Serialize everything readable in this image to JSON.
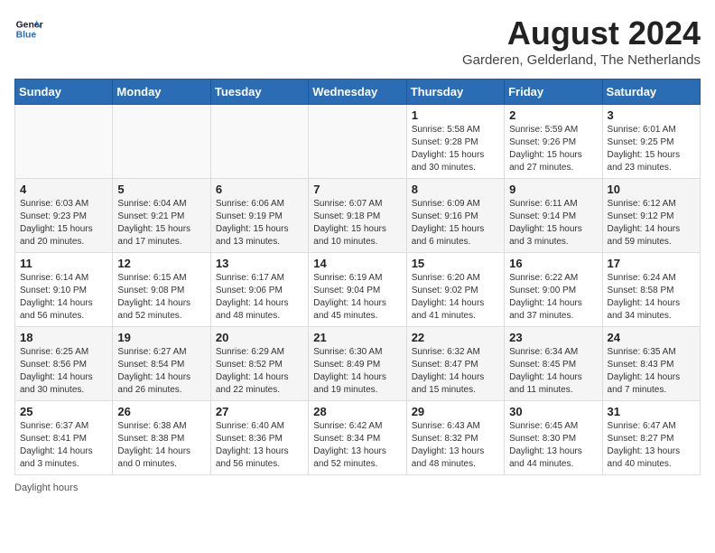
{
  "header": {
    "logo_line1": "General",
    "logo_line2": "Blue",
    "month_year": "August 2024",
    "location": "Garderen, Gelderland, The Netherlands"
  },
  "weekdays": [
    "Sunday",
    "Monday",
    "Tuesday",
    "Wednesday",
    "Thursday",
    "Friday",
    "Saturday"
  ],
  "weeks": [
    [
      {
        "day": "",
        "info": ""
      },
      {
        "day": "",
        "info": ""
      },
      {
        "day": "",
        "info": ""
      },
      {
        "day": "",
        "info": ""
      },
      {
        "day": "1",
        "info": "Sunrise: 5:58 AM\nSunset: 9:28 PM\nDaylight: 15 hours and 30 minutes."
      },
      {
        "day": "2",
        "info": "Sunrise: 5:59 AM\nSunset: 9:26 PM\nDaylight: 15 hours and 27 minutes."
      },
      {
        "day": "3",
        "info": "Sunrise: 6:01 AM\nSunset: 9:25 PM\nDaylight: 15 hours and 23 minutes."
      }
    ],
    [
      {
        "day": "4",
        "info": "Sunrise: 6:03 AM\nSunset: 9:23 PM\nDaylight: 15 hours and 20 minutes."
      },
      {
        "day": "5",
        "info": "Sunrise: 6:04 AM\nSunset: 9:21 PM\nDaylight: 15 hours and 17 minutes."
      },
      {
        "day": "6",
        "info": "Sunrise: 6:06 AM\nSunset: 9:19 PM\nDaylight: 15 hours and 13 minutes."
      },
      {
        "day": "7",
        "info": "Sunrise: 6:07 AM\nSunset: 9:18 PM\nDaylight: 15 hours and 10 minutes."
      },
      {
        "day": "8",
        "info": "Sunrise: 6:09 AM\nSunset: 9:16 PM\nDaylight: 15 hours and 6 minutes."
      },
      {
        "day": "9",
        "info": "Sunrise: 6:11 AM\nSunset: 9:14 PM\nDaylight: 15 hours and 3 minutes."
      },
      {
        "day": "10",
        "info": "Sunrise: 6:12 AM\nSunset: 9:12 PM\nDaylight: 14 hours and 59 minutes."
      }
    ],
    [
      {
        "day": "11",
        "info": "Sunrise: 6:14 AM\nSunset: 9:10 PM\nDaylight: 14 hours and 56 minutes."
      },
      {
        "day": "12",
        "info": "Sunrise: 6:15 AM\nSunset: 9:08 PM\nDaylight: 14 hours and 52 minutes."
      },
      {
        "day": "13",
        "info": "Sunrise: 6:17 AM\nSunset: 9:06 PM\nDaylight: 14 hours and 48 minutes."
      },
      {
        "day": "14",
        "info": "Sunrise: 6:19 AM\nSunset: 9:04 PM\nDaylight: 14 hours and 45 minutes."
      },
      {
        "day": "15",
        "info": "Sunrise: 6:20 AM\nSunset: 9:02 PM\nDaylight: 14 hours and 41 minutes."
      },
      {
        "day": "16",
        "info": "Sunrise: 6:22 AM\nSunset: 9:00 PM\nDaylight: 14 hours and 37 minutes."
      },
      {
        "day": "17",
        "info": "Sunrise: 6:24 AM\nSunset: 8:58 PM\nDaylight: 14 hours and 34 minutes."
      }
    ],
    [
      {
        "day": "18",
        "info": "Sunrise: 6:25 AM\nSunset: 8:56 PM\nDaylight: 14 hours and 30 minutes."
      },
      {
        "day": "19",
        "info": "Sunrise: 6:27 AM\nSunset: 8:54 PM\nDaylight: 14 hours and 26 minutes."
      },
      {
        "day": "20",
        "info": "Sunrise: 6:29 AM\nSunset: 8:52 PM\nDaylight: 14 hours and 22 minutes."
      },
      {
        "day": "21",
        "info": "Sunrise: 6:30 AM\nSunset: 8:49 PM\nDaylight: 14 hours and 19 minutes."
      },
      {
        "day": "22",
        "info": "Sunrise: 6:32 AM\nSunset: 8:47 PM\nDaylight: 14 hours and 15 minutes."
      },
      {
        "day": "23",
        "info": "Sunrise: 6:34 AM\nSunset: 8:45 PM\nDaylight: 14 hours and 11 minutes."
      },
      {
        "day": "24",
        "info": "Sunrise: 6:35 AM\nSunset: 8:43 PM\nDaylight: 14 hours and 7 minutes."
      }
    ],
    [
      {
        "day": "25",
        "info": "Sunrise: 6:37 AM\nSunset: 8:41 PM\nDaylight: 14 hours and 3 minutes."
      },
      {
        "day": "26",
        "info": "Sunrise: 6:38 AM\nSunset: 8:38 PM\nDaylight: 14 hours and 0 minutes."
      },
      {
        "day": "27",
        "info": "Sunrise: 6:40 AM\nSunset: 8:36 PM\nDaylight: 13 hours and 56 minutes."
      },
      {
        "day": "28",
        "info": "Sunrise: 6:42 AM\nSunset: 8:34 PM\nDaylight: 13 hours and 52 minutes."
      },
      {
        "day": "29",
        "info": "Sunrise: 6:43 AM\nSunset: 8:32 PM\nDaylight: 13 hours and 48 minutes."
      },
      {
        "day": "30",
        "info": "Sunrise: 6:45 AM\nSunset: 8:30 PM\nDaylight: 13 hours and 44 minutes."
      },
      {
        "day": "31",
        "info": "Sunrise: 6:47 AM\nSunset: 8:27 PM\nDaylight: 13 hours and 40 minutes."
      }
    ]
  ],
  "footer": "Daylight hours"
}
